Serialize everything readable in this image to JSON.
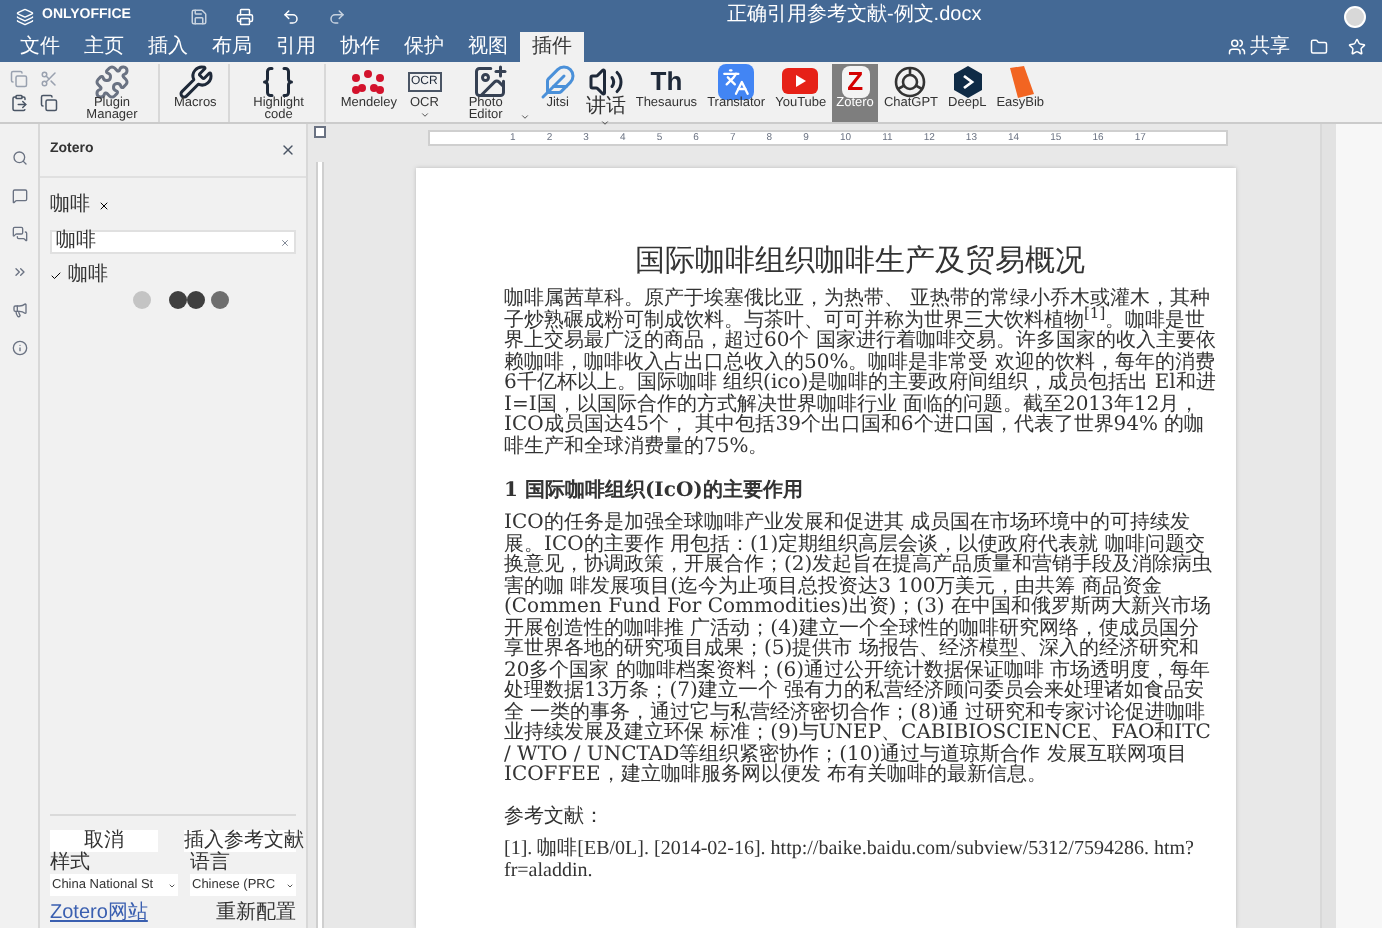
{
  "app": {
    "name": "ONLYOFFICE",
    "document_title": "正确引用参考文献-例文.docx",
    "share_label": "共享"
  },
  "tabs": [
    {
      "label": "文件",
      "selected": false
    },
    {
      "label": "主页",
      "selected": false
    },
    {
      "label": "插入",
      "selected": false
    },
    {
      "label": "布局",
      "selected": false
    },
    {
      "label": "引用",
      "selected": false
    },
    {
      "label": "协作",
      "selected": false
    },
    {
      "label": "保护",
      "selected": false
    },
    {
      "label": "视图",
      "selected": false
    },
    {
      "label": "插件",
      "selected": true
    }
  ],
  "toolbar": [
    {
      "kind": "puzzle",
      "label": "Plugin Manager",
      "dropdown": false,
      "selected": false
    },
    {
      "kind": "tools",
      "label": "Macros",
      "dropdown": false,
      "selected": false
    },
    {
      "kind": "braces",
      "label": "Highlight code",
      "dropdown": false,
      "selected": false
    },
    {
      "kind": "dots",
      "label": "Mendeley",
      "dropdown": false,
      "selected": false
    },
    {
      "kind": "ocr",
      "label": "OCR",
      "icon_text": "OCR",
      "dropdown": true,
      "selected": false
    },
    {
      "kind": "photo",
      "label": "Photo Editor",
      "dropdown": true,
      "selected": false
    },
    {
      "kind": "feather",
      "label": "Jitsi",
      "dropdown": false,
      "selected": false
    },
    {
      "kind": "speaker",
      "label": "讲话",
      "dropdown": true,
      "selected": false
    },
    {
      "kind": "letters",
      "label": "Thesaurus",
      "icon_text": "Th",
      "dropdown": false,
      "selected": false
    },
    {
      "kind": "translate",
      "label": "Translator",
      "dropdown": false,
      "selected": false
    },
    {
      "kind": "play",
      "label": "YouTube",
      "dropdown": false,
      "selected": false
    },
    {
      "kind": "letters_red",
      "label": "Zotero",
      "icon_text": "Z",
      "dropdown": false,
      "selected": true
    },
    {
      "kind": "knot",
      "label": "ChatGPT",
      "dropdown": false,
      "selected": false
    },
    {
      "kind": "hexagon",
      "label": "DeepL",
      "dropdown": false,
      "selected": false
    },
    {
      "kind": "book",
      "label": "EasyBib",
      "dropdown": false,
      "selected": false
    }
  ],
  "ruler_numbers": [
    "1",
    "2",
    "3",
    "4",
    "5",
    "6",
    "7",
    "8",
    "9",
    "10",
    "11",
    "12",
    "13",
    "14",
    "15",
    "16",
    "17"
  ],
  "zotero": {
    "title": "Zotero",
    "tag": "咖啡",
    "search_value": "咖啡",
    "items": [
      {
        "label": "咖啡",
        "checked": true
      }
    ],
    "cancel_button": "取消",
    "insert_button": "插入参考文献",
    "style_label": "样式",
    "style_value": "China National St",
    "language_label": "语言",
    "language_value": "Chinese (PRC",
    "website_link": "Zotero网站",
    "reconfigure_link": "重新配置"
  },
  "document": {
    "title": "国际咖啡组织咖啡生产及贸易概况",
    "paragraph_1": "咖啡属茜草科。原产于埃塞俄比亚，为热带、 亚热带的常绿小乔木或灌木，其种子炒熟碾成粉可制成饮料。与茶叶、可可并称为世界三大饮料植物$^{[1]}$。咖啡是世界上交易最广泛的商品，超过60个 国家进行着咖啡交易。许多国家的收入主要依赖咖啡，咖啡收入占出口总收入的50%。咖啡是非常受 欢迎的饮料，每年的消费6千亿杯以上。国际咖啡 组织(ico)是咖啡的主要政府间组织，成员包括出 El和进I=I国，以国际合作的方式解决世界咖啡行业 面临的问题。截至2013年12月，ICO成员国达45个， 其中包括39个出口国和6个进口国，代表了世界94% 的咖啡生产和全球消费量的75%。",
    "heading": "1 国际咖啡组织(IcO)的主要作用",
    "paragraph_2": "ICO的任务是加强全球咖啡产业发展和促进其 成员国在市场环境中的可持续发展。ICO的主要作 用包括：(1)定期组织高层会谈，以使政府代表就 咖啡问题交换意见，协调政策，开展合作；(2)发起旨在提高产品质量和营销手段及消除病虫害的咖 啡发展项目(迄今为止项目总投资达3 100万美元，由共筹 商品资金(Commen Fund For Commodities)出资)；(3) 在中国和俄罗斯两大新兴市场开展创造性的咖啡推 广活动；(4)建立一个全球性的咖啡研究网络，使成员国分享世界各地的研究项目成果；(5)提供市 场报告、经济模型、深入的经济研究和20多个国家 的咖啡档案资料；(6)通过公开统计数据保证咖啡 市场透明度，每年处理数据13万条；(7)建立一个 强有力的私营经济顾问委员会来处理诸如食品安全 一类的事务，通过它与私营经济密切合作；(8)通 过研究和专家讨论促进咖啡业持续发展及建立环保 标准；(9)与UNEP、CABIBIOSCIENCE、FAO和ITC / WTO  / UNCTAD等组织紧密协作；(10)通过与道琼斯合作 发展互联网项目ICOFFEE，建立咖啡服务网以便发 布有关咖啡的最新信息。",
    "references_heading": "参考文献：",
    "reference_1": "[1]. 咖啡[EB/0L]. [2014-02-16]. http://baike.baidu.com/subview/5312/7594286. htm?fr=aladdin."
  }
}
